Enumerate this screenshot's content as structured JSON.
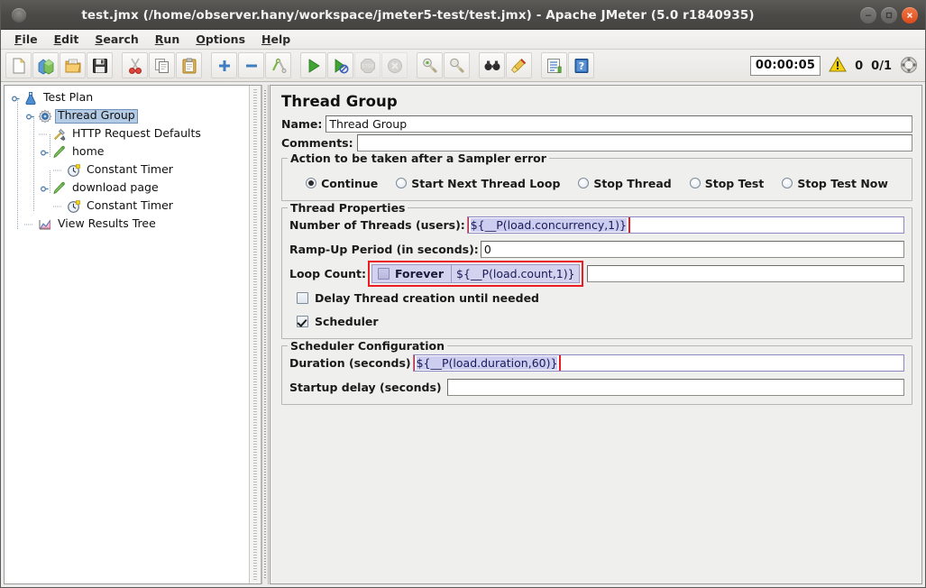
{
  "window": {
    "title": "test.jmx (/home/observer.hany/workspace/jmeter5-test/test.jmx) - Apache JMeter (5.0 r1840935)",
    "minimize_label": "–",
    "maximize_label": "□",
    "close_label": "✕"
  },
  "menubar": {
    "items": [
      {
        "mnemonic": "F",
        "rest": "ile"
      },
      {
        "mnemonic": "E",
        "rest": "dit"
      },
      {
        "mnemonic": "S",
        "rest": "earch"
      },
      {
        "mnemonic": "R",
        "rest": "un"
      },
      {
        "mnemonic": "O",
        "rest": "ptions"
      },
      {
        "mnemonic": "H",
        "rest": "elp"
      }
    ]
  },
  "toolbar": {
    "buttons": [
      {
        "name": "new-icon",
        "tip": "New"
      },
      {
        "name": "templates-icon",
        "tip": "Templates"
      },
      {
        "name": "open-icon",
        "tip": "Open"
      },
      {
        "name": "save-icon",
        "tip": "Save"
      },
      {
        "name": "cut-icon",
        "tip": "Cut"
      },
      {
        "name": "copy-icon",
        "tip": "Copy"
      },
      {
        "name": "paste-icon",
        "tip": "Paste"
      },
      {
        "name": "expand-all-icon",
        "tip": "Expand All"
      },
      {
        "name": "collapse-all-icon",
        "tip": "Collapse All"
      },
      {
        "name": "toggle-icon",
        "tip": "Toggle"
      },
      {
        "name": "start-icon",
        "tip": "Start"
      },
      {
        "name": "start-no-timers-icon",
        "tip": "Start no pauses"
      },
      {
        "name": "stop-icon",
        "tip": "Stop"
      },
      {
        "name": "shutdown-icon",
        "tip": "Shutdown"
      },
      {
        "name": "clear-icon",
        "tip": "Clear"
      },
      {
        "name": "clear-all-icon",
        "tip": "Clear All"
      },
      {
        "name": "search-icon",
        "tip": "Search"
      },
      {
        "name": "reset-search-icon",
        "tip": "Reset Search"
      },
      {
        "name": "function-helper-icon",
        "tip": "Function Helper Dialog"
      },
      {
        "name": "help-icon",
        "tip": "Help"
      }
    ],
    "elapsed_time": "00:00:05",
    "warning_count": "0",
    "thread_counts": "0/1"
  },
  "tree": {
    "nodes": [
      {
        "label": "Test Plan",
        "icon": "test-plan-icon",
        "depth": 0,
        "selected": false
      },
      {
        "label": "Thread Group",
        "icon": "thread-group-icon",
        "depth": 1,
        "selected": true
      },
      {
        "label": "HTTP Request Defaults",
        "icon": "http-defaults-icon",
        "depth": 2,
        "selected": false
      },
      {
        "label": "home",
        "icon": "http-sampler-icon",
        "depth": 2,
        "selected": false
      },
      {
        "label": "Constant Timer",
        "icon": "timer-icon",
        "depth": 3,
        "selected": false
      },
      {
        "label": "download page",
        "icon": "http-sampler-icon",
        "depth": 2,
        "selected": false
      },
      {
        "label": "Constant Timer",
        "icon": "timer-icon",
        "depth": 3,
        "selected": false
      },
      {
        "label": "View Results Tree",
        "icon": "view-results-tree-icon",
        "depth": 2,
        "selected": false
      }
    ]
  },
  "main": {
    "title": "Thread Group",
    "name_label": "Name:",
    "name_value": "Thread Group",
    "comments_label": "Comments:",
    "comments_value": "",
    "sampler_error": {
      "group_title": "Action to be taken after a Sampler error",
      "options": [
        {
          "label": "Continue",
          "checked": true
        },
        {
          "label": "Start Next Thread Loop",
          "checked": false
        },
        {
          "label": "Stop Thread",
          "checked": false
        },
        {
          "label": "Stop Test",
          "checked": false
        },
        {
          "label": "Stop Test Now",
          "checked": false
        }
      ]
    },
    "thread_properties": {
      "group_title": "Thread Properties",
      "num_threads_label": "Number of Threads (users):",
      "num_threads_value": "${__P(load.concurrency,1)}",
      "ramp_up_label": "Ramp-Up Period (in seconds):",
      "ramp_up_value": "0",
      "loop_count_label": "Loop Count:",
      "forever_label": "Forever",
      "forever_checked": false,
      "loop_count_value": "${__P(load.count,1)}",
      "delay_thread_label": "Delay Thread creation until needed",
      "delay_thread_checked": false,
      "scheduler_label": "Scheduler",
      "scheduler_checked": true
    },
    "scheduler": {
      "group_title": "Scheduler Configuration",
      "duration_label": "Duration (seconds)",
      "duration_value": "${__P(load.duration,60)}",
      "startup_delay_label": "Startup delay (seconds)",
      "startup_delay_value": ""
    }
  },
  "colors": {
    "highlight_red": "#ec1c24",
    "selection_blue": "#b4cbe5",
    "field_selection": "#cdcdf0",
    "titlebar": "#4b4946"
  }
}
